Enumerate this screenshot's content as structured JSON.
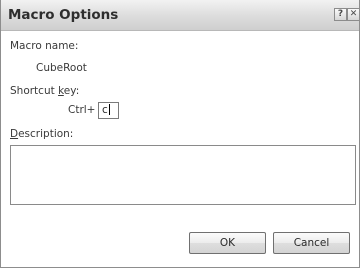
{
  "window": {
    "title": "Macro Options",
    "help_glyph": "?",
    "close_glyph": "✕"
  },
  "macro_name": {
    "label": "Macro name:",
    "value": "CubeRoot"
  },
  "shortcut": {
    "label_pre": "Shortcut ",
    "label_ul": "k",
    "label_post": "ey:",
    "prefix": "Ctrl+",
    "value": "c"
  },
  "description": {
    "label_ul": "D",
    "label_post": "escription:",
    "value": ""
  },
  "buttons": {
    "ok": "OK",
    "cancel": "Cancel"
  }
}
